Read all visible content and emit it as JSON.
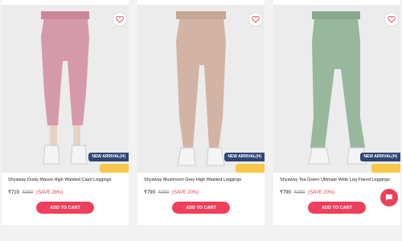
{
  "products": [
    {
      "title": "Shyaway Dusty Mauve High Waisted Capri Leggings",
      "price": "₹719",
      "mrp": "₹999",
      "save": "(SAVE 28%)",
      "cart_label": "ADD TO CART",
      "badge_new": "NEW ARRIVAL(H)",
      "badge_offer": "",
      "color": "#d59aa9"
    },
    {
      "title": "Shyaway Mushroom Grey High Waisted Leggings",
      "price": "₹799",
      "mrp": "₹999",
      "save": "(SAVE 20%)",
      "cart_label": "ADD TO CART",
      "badge_new": "NEW ARRIVAL(H)",
      "badge_offer": "",
      "color": "#d3b3a3"
    },
    {
      "title": "Shyaway Tea Green Ultimate Wide Leg Flared Leggings",
      "price": "₹799",
      "mrp": "₹999",
      "save": "(SAVE 20%)",
      "cart_label": "ADD TO CART",
      "badge_new": "NEW ARRIVAL(H)",
      "badge_offer": "",
      "color": "#98b79d"
    }
  ],
  "icons": {
    "wishlist": "heart-icon",
    "chat": "chat-icon"
  },
  "accent": "#ef3f5a"
}
